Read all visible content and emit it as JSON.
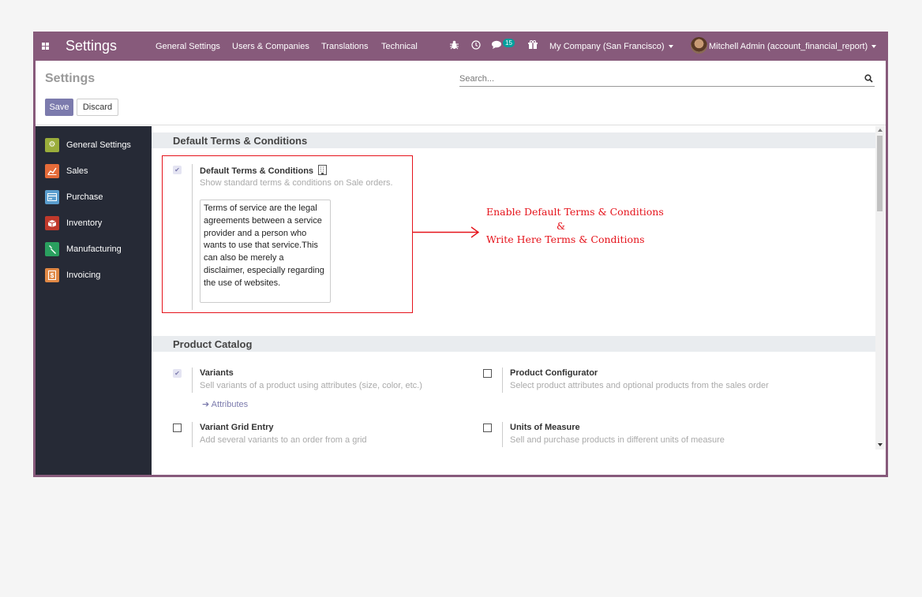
{
  "navbar": {
    "brand": "Settings",
    "menu": [
      "General Settings",
      "Users & Companies",
      "Translations",
      "Technical"
    ],
    "messages_count": "15",
    "company": "My Company (San Francisco)",
    "user": "Mitchell Admin (account_financial_report)"
  },
  "control": {
    "title": "Settings",
    "search_placeholder": "Search...",
    "save_label": "Save",
    "discard_label": "Discard"
  },
  "sidebar": {
    "items": [
      {
        "label": "General Settings",
        "icon": "gear-icon",
        "color": "#9aad3b"
      },
      {
        "label": "Sales",
        "icon": "chart-icon",
        "color": "#e56b39"
      },
      {
        "label": "Purchase",
        "icon": "card-icon",
        "color": "#5a9dce"
      },
      {
        "label": "Inventory",
        "icon": "box-icon",
        "color": "#c0392b"
      },
      {
        "label": "Manufacturing",
        "icon": "wrench-icon",
        "color": "#2aa05f"
      },
      {
        "label": "Invoicing",
        "icon": "invoice-icon",
        "color": "#e08845"
      }
    ]
  },
  "sections": {
    "terms": {
      "header": "Default Terms & Conditions",
      "option_title": "Default Terms & Conditions",
      "option_desc": "Show standard terms & conditions on Sale orders.",
      "checked": true,
      "text": "Terms of service are the legal agreements between a service provider and a person who wants to use that service.This can also be merely a disclaimer, especially regarding the use of websites."
    },
    "catalog": {
      "header": "Product Catalog",
      "variants": {
        "title": "Variants",
        "desc": "Sell variants of a product using attributes (size, color, etc.)",
        "link": "Attributes",
        "checked": true
      },
      "configurator": {
        "title": "Product Configurator",
        "desc": "Select product attributes and optional products from the sales order",
        "checked": false
      },
      "grid": {
        "title": "Variant Grid Entry",
        "desc": "Add several variants to an order from a grid",
        "checked": false
      },
      "uom": {
        "title": "Units of Measure",
        "desc": "Sell and purchase products in different units of measure",
        "checked": false
      }
    }
  },
  "annotation": {
    "line1": "Enable Default Terms & Conditions",
    "line2": "&",
    "line3": "Write Here Terms & Conditions"
  },
  "colors": {
    "accent": "#875a7b",
    "primary": "#7c7bad",
    "annotation": "#e5131b",
    "sidebar": "#262a36"
  }
}
